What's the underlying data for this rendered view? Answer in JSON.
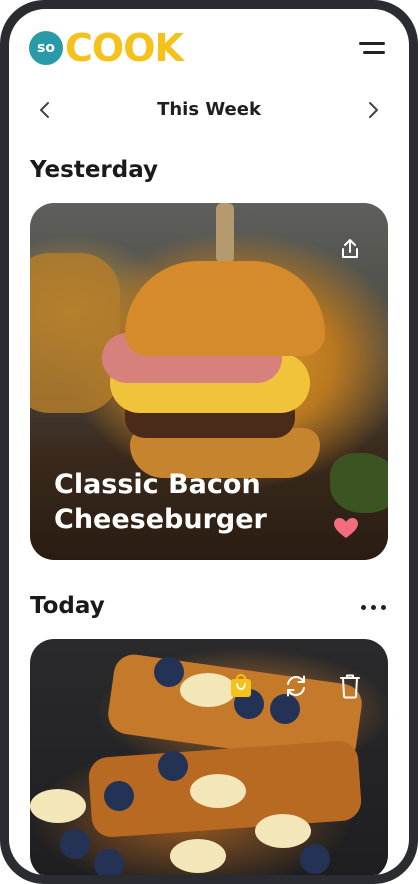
{
  "header": {
    "logo_badge": "so",
    "logo_text": "COOK",
    "menu_icon": "hamburger-menu-icon"
  },
  "week_nav": {
    "title": "This Week",
    "prev_icon": "chevron-left-icon",
    "next_icon": "chevron-right-icon"
  },
  "sections": [
    {
      "title": "Yesterday",
      "card": {
        "title_line1": "Classic Bacon",
        "title_line2": "Cheeseburger",
        "icons": [
          "share-icon",
          "heart-icon"
        ]
      }
    },
    {
      "title": "Today",
      "more_icon": "more-horizontal-icon",
      "card": {
        "icons": [
          "shopping-bag-icon",
          "swap-icon",
          "trash-icon"
        ]
      }
    }
  ],
  "colors": {
    "brand_yellow": "#f4c21b",
    "brand_teal": "#2b9aa8",
    "heart_pink": "#f26d7d",
    "bag_yellow": "#f4c21b",
    "text_dark": "#1a1a1a",
    "frame": "#2b2c31"
  }
}
